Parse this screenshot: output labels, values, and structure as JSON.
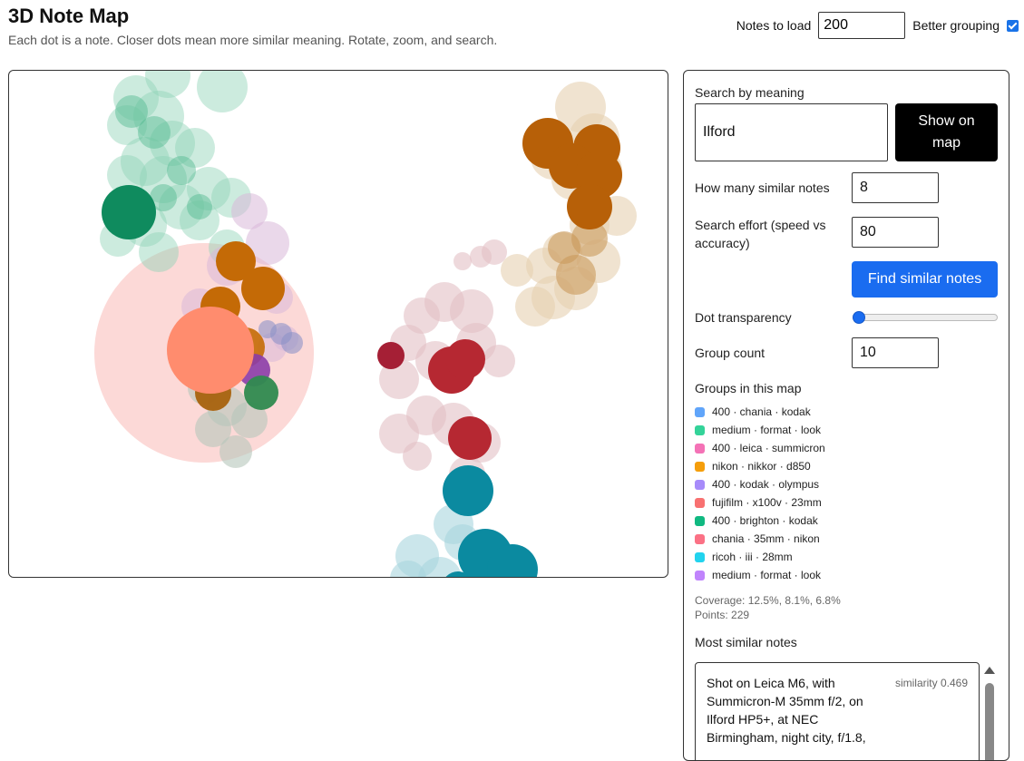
{
  "header": {
    "title": "3D Note Map",
    "subtitle": "Each dot is a note. Closer dots mean more similar meaning. Rotate, zoom, and search.",
    "notes_to_load_label": "Notes to load",
    "notes_to_load_value": "200",
    "better_grouping_label": "Better grouping",
    "better_grouping_checked": true
  },
  "panel": {
    "search_label": "Search by meaning",
    "search_value": "Ilford",
    "show_button": "Show on map",
    "similar_label": "How many similar notes",
    "similar_value": "8",
    "effort_label": "Search effort (speed vs accuracy)",
    "effort_value": "80",
    "find_button": "Find similar notes",
    "transparency_label": "Dot transparency",
    "transparency_value": 0,
    "group_count_label": "Group count",
    "group_count_value": "10",
    "groups_title": "Groups in this map",
    "groups": [
      {
        "label": "400 · chania · kodak",
        "color": "#60a5fa"
      },
      {
        "label": "medium · format · look",
        "color": "#34d399"
      },
      {
        "label": "400 · leica · summicron",
        "color": "#f472b6"
      },
      {
        "label": "nikon · nikkor · d850",
        "color": "#f59e0b"
      },
      {
        "label": "400 · kodak · olympus",
        "color": "#a78bfa"
      },
      {
        "label": "fujifilm · x100v · 23mm",
        "color": "#f87171"
      },
      {
        "label": "400 · brighton · kodak",
        "color": "#10b981"
      },
      {
        "label": "chania · 35mm · nikon",
        "color": "#fb7185"
      },
      {
        "label": "ricoh · iii · 28mm",
        "color": "#22d3ee"
      },
      {
        "label": "medium · format · look",
        "color": "#c084fc"
      }
    ],
    "coverage": "Coverage: 12.5%, 8.1%, 6.8%",
    "points": "Points: 229",
    "most_similar_title": "Most similar notes",
    "top_note": {
      "text": "Shot on Leica M6, with Summicron-M 35mm f/2, on Ilford HP5+, at NEC Birmingham, night city, f/1.8,",
      "similarity": "similarity 0.469"
    }
  }
}
